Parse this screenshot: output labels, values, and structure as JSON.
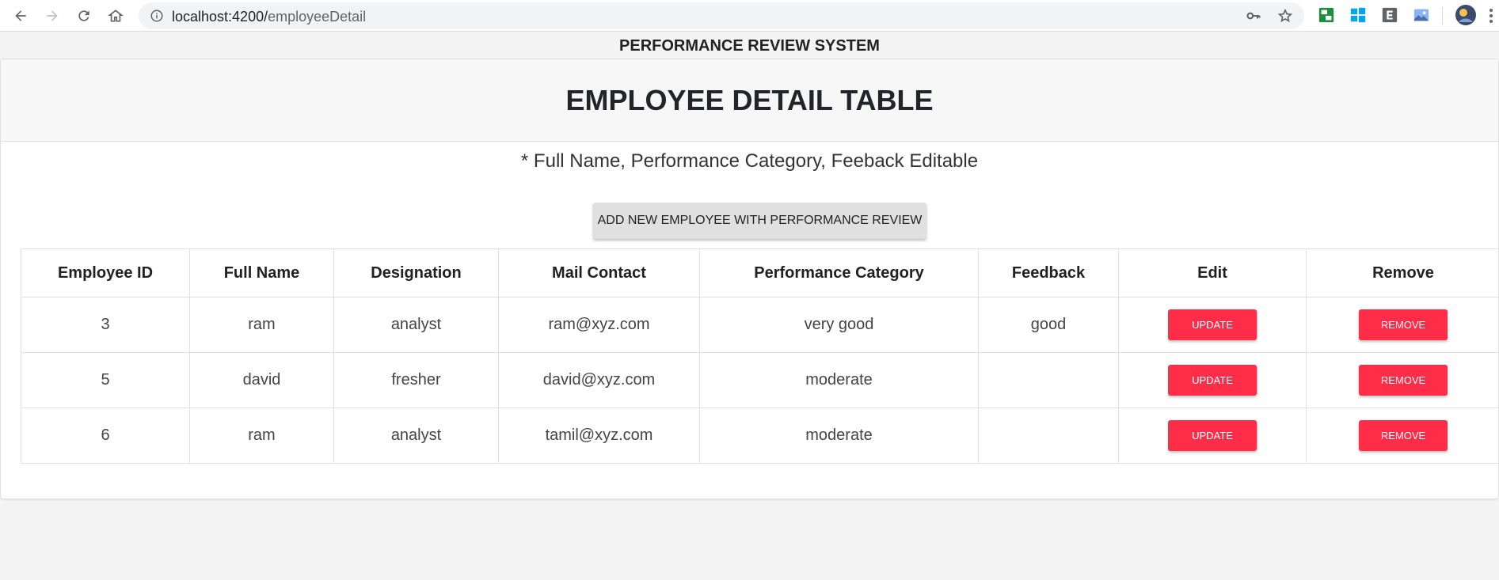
{
  "browser": {
    "url_host": "localhost:4200/",
    "url_path": "employeeDetail"
  },
  "app": {
    "title": "PERFORMANCE REVIEW SYSTEM"
  },
  "card": {
    "heading": "EMPLOYEE DETAIL TABLE",
    "note": "* Full Name, Performance Category, Feeback Editable",
    "add_button": "ADD NEW EMPLOYEE WITH PERFORMANCE REVIEW"
  },
  "table": {
    "headers": [
      "Employee ID",
      "Full Name",
      "Designation",
      "Mail Contact",
      "Performance Category",
      "Feedback",
      "Edit",
      "Remove"
    ],
    "rows": [
      {
        "id": "3",
        "name": "ram",
        "designation": "analyst",
        "mail": "ram@xyz.com",
        "category": "very good",
        "feedback": "good",
        "update": "UPDATE",
        "remove": "REMOVE"
      },
      {
        "id": "5",
        "name": "david",
        "designation": "fresher",
        "mail": "david@xyz.com",
        "category": "moderate",
        "feedback": "",
        "update": "UPDATE",
        "remove": "REMOVE"
      },
      {
        "id": "6",
        "name": "ram",
        "designation": "analyst",
        "mail": "tamil@xyz.com",
        "category": "moderate",
        "feedback": "",
        "update": "UPDATE",
        "remove": "REMOVE"
      }
    ]
  },
  "colors": {
    "danger": "#ff2d48",
    "header_bg": "#f7f7f7",
    "page_bg": "#f4f4f4"
  },
  "icons": [
    "back-icon",
    "forward-icon",
    "reload-icon",
    "home-icon",
    "info-icon",
    "key-icon",
    "star-icon",
    "extension-icon",
    "windows-icon",
    "extension-e-icon",
    "photo-extension-icon",
    "avatar",
    "menu-dots-icon"
  ]
}
